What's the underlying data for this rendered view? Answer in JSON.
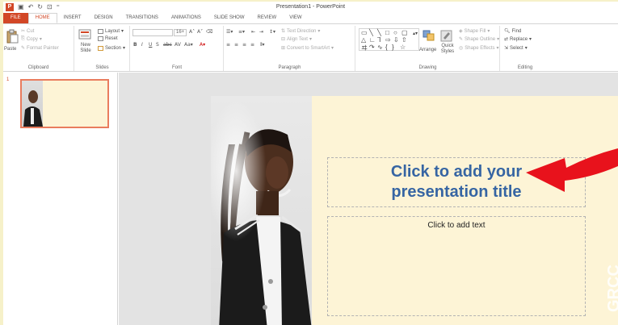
{
  "window": {
    "title": "Presentation1 - PowerPoint"
  },
  "tabs": [
    {
      "label": "FILE"
    },
    {
      "label": "HOME"
    },
    {
      "label": "INSERT"
    },
    {
      "label": "DESIGN"
    },
    {
      "label": "TRANSITIONS"
    },
    {
      "label": "ANIMATIONS"
    },
    {
      "label": "SLIDE SHOW"
    },
    {
      "label": "REVIEW"
    },
    {
      "label": "VIEW"
    }
  ],
  "ribbon": {
    "clipboard": {
      "paste": "Paste",
      "cut": "Cut",
      "copy": "Copy",
      "format_painter": "Format Painter",
      "label": "Clipboard"
    },
    "slides": {
      "new_slide": "New Slide",
      "layout": "Layout",
      "reset": "Reset",
      "section": "Section",
      "label": "Slides"
    },
    "font": {
      "size": "16+",
      "label": "Font",
      "aa": "Aa"
    },
    "paragraph": {
      "text_direction": "Text Direction",
      "align_text": "Align Text",
      "smartart": "Convert to SmartArt",
      "label": "Paragraph"
    },
    "drawing": {
      "arrange": "Arrange",
      "quick_styles": "Quick Styles",
      "shape_fill": "Shape Fill",
      "shape_outline": "Shape Outline",
      "shape_effects": "Shape Effects",
      "label": "Drawing"
    },
    "editing": {
      "find": "Find",
      "replace": "Replace",
      "select": "Select",
      "label": "Editing"
    }
  },
  "thumbnails": [
    {
      "number": "1"
    }
  ],
  "slide": {
    "title_placeholder": "Click to add your presentation title",
    "subtitle_placeholder": "Click to add text",
    "watermark": "GRCC"
  },
  "colors": {
    "accent": "#d24726",
    "title_text": "#3665a3",
    "slide_background": "#fdf4d6",
    "arrow": "#e8121c"
  }
}
